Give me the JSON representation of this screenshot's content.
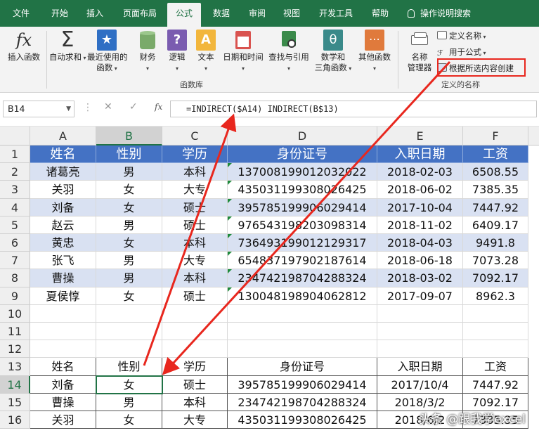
{
  "tabs": [
    "文件",
    "开始",
    "插入",
    "页面布局",
    "公式",
    "数据",
    "审阅",
    "视图",
    "开发工具",
    "帮助",
    "操作说明搜索"
  ],
  "ribbon": {
    "insert_function": "插入函数",
    "autosum": "自动求和",
    "recent_1": "最近使用的",
    "recent_2": "函数",
    "financial": "财务",
    "logical": "逻辑",
    "text": "文本",
    "datetime": "日期和时间",
    "lookup": "查找与引用",
    "math_1": "数学和",
    "math_2": "三角函数",
    "other": "其他函数",
    "group_library": "函数库",
    "name_mgr_1": "名称",
    "name_mgr_2": "管理器",
    "define_name": "定义名称",
    "use_in_formula": "用于公式",
    "create_from_selection": "根据所选内容创建",
    "group_names": "定义的名称"
  },
  "formula_bar": {
    "name_box": "B14",
    "fx": "fx",
    "formula": "=INDIRECT($A14) INDIRECT(B$13)"
  },
  "columns": [
    "A",
    "B",
    "C",
    "D",
    "E",
    "F"
  ],
  "rows": [
    "1",
    "2",
    "3",
    "4",
    "5",
    "6",
    "7",
    "8",
    "9",
    "10",
    "11",
    "12",
    "13",
    "14",
    "15",
    "16"
  ],
  "table1": {
    "header": [
      "姓名",
      "性别",
      "学历",
      "身份证号",
      "入职日期",
      "工资"
    ],
    "rows": [
      [
        "诸葛亮",
        "男",
        "本科",
        "137008199012032022",
        "2018-02-03",
        "6508.55"
      ],
      [
        "关羽",
        "女",
        "大专",
        "435031199308026425",
        "2018-06-02",
        "7385.35"
      ],
      [
        "刘备",
        "女",
        "硕士",
        "395785199906029414",
        "2017-10-04",
        "7447.92"
      ],
      [
        "赵云",
        "男",
        "硕士",
        "976543198203098314",
        "2018-11-02",
        "6409.17"
      ],
      [
        "黄忠",
        "女",
        "本科",
        "736493199012129317",
        "2018-04-03",
        "9491.8"
      ],
      [
        "张飞",
        "男",
        "大专",
        "654837197902187614",
        "2018-06-18",
        "7073.28"
      ],
      [
        "曹操",
        "男",
        "本科",
        "234742198704288324",
        "2018-03-02",
        "7092.17"
      ],
      [
        "夏侯惇",
        "女",
        "硕士",
        "130048198904062812",
        "2017-09-07",
        "8962.3"
      ]
    ]
  },
  "table2": {
    "header": [
      "姓名",
      "性别",
      "学历",
      "身份证号",
      "入职日期",
      "工资"
    ],
    "rows": [
      [
        "刘备",
        "女",
        "硕士",
        "395785199906029414",
        "2017/10/4",
        "7447.92"
      ],
      [
        "曹操",
        "男",
        "本科",
        "234742198704288324",
        "2018/3/2",
        "7092.17"
      ],
      [
        "关羽",
        "女",
        "大专",
        "435031199308026425",
        "2018/6/2",
        "7385.35"
      ]
    ]
  },
  "watermark": "头条 @跟我学excel",
  "colors": {
    "excel_green": "#217346",
    "header_blue": "#4472c4",
    "band_blue": "#d9e1f2",
    "arrow_red": "#e8271e"
  }
}
